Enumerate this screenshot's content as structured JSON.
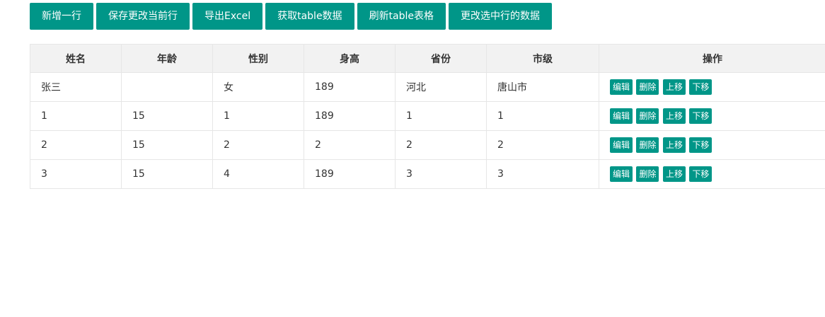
{
  "toolbar": {
    "buttons": [
      {
        "label": "新增一行"
      },
      {
        "label": "保存更改当前行"
      },
      {
        "label": "导出Excel"
      },
      {
        "label": "获取table数据"
      },
      {
        "label": "刷新table表格"
      },
      {
        "label": "更改选中行的数据"
      }
    ]
  },
  "table": {
    "headers": [
      "姓名",
      "年龄",
      "性别",
      "身高",
      "省份",
      "市级",
      "操作"
    ],
    "rows": [
      {
        "cells": [
          "张三",
          "",
          "女",
          "189",
          "河北",
          "唐山市"
        ]
      },
      {
        "cells": [
          "1",
          "15",
          "1",
          "189",
          "1",
          "1"
        ]
      },
      {
        "cells": [
          "2",
          "15",
          "2",
          "2",
          "2",
          "2"
        ]
      },
      {
        "cells": [
          "3",
          "15",
          "4",
          "189",
          "3",
          "3"
        ]
      }
    ],
    "row_actions": [
      "编辑",
      "删除",
      "上移",
      "下移"
    ]
  },
  "colors": {
    "accent": "#009688",
    "header_bg": "#f2f2f2",
    "border": "#e6e6e6"
  }
}
